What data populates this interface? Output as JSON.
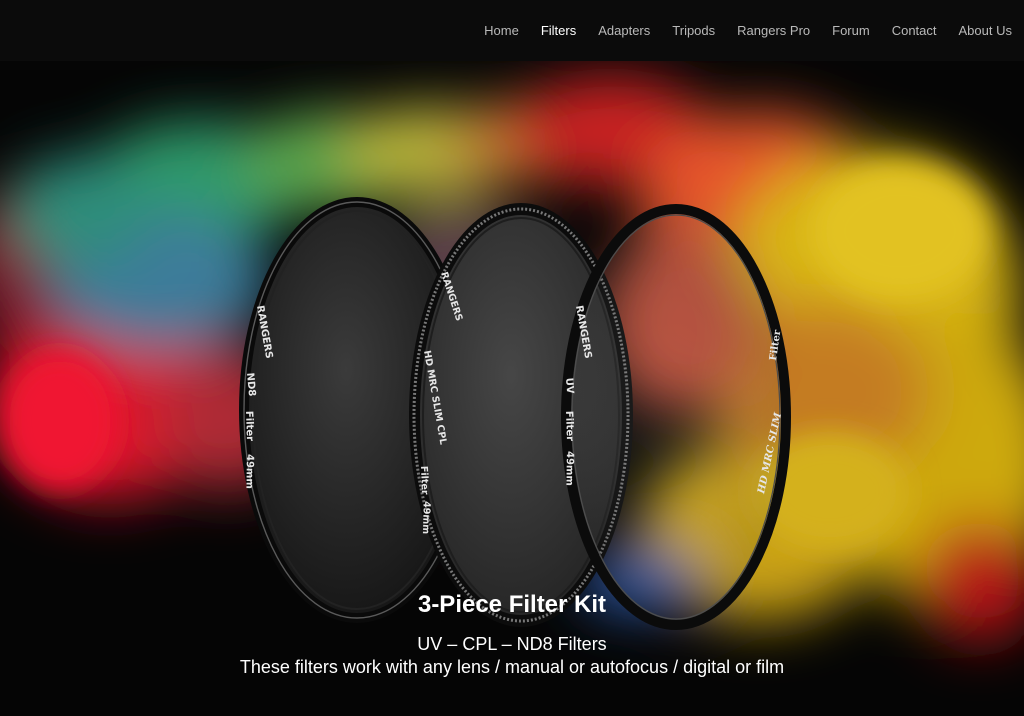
{
  "nav": {
    "items": [
      {
        "label": "Home"
      },
      {
        "label": "Filters"
      },
      {
        "label": "Adapters"
      },
      {
        "label": "Tripods"
      },
      {
        "label": "Rangers Pro"
      },
      {
        "label": "Forum"
      },
      {
        "label": "Contact"
      },
      {
        "label": "About Us"
      }
    ],
    "active": "Filters"
  },
  "hero": {
    "title": "3-Piece Filter Kit",
    "subtitle": "UV – CPL – ND8 Filters",
    "description": "These filters work with any lens / manual or autofocus / digital or film",
    "filters": [
      {
        "name": "nd8",
        "brand": "RANGERS",
        "type": "ND8",
        "label": "Filter",
        "size": "49mm"
      },
      {
        "name": "cpl",
        "brand": "RANGERS",
        "type": "HD MRC SLIM CPL",
        "label": "Filter",
        "size": "49mm"
      },
      {
        "name": "uv",
        "brand": "RANGERS",
        "type": "UV",
        "label": "Filter",
        "size": "49mm",
        "back_text": "HD MRC SLIM",
        "back_label": "Filter"
      }
    ]
  },
  "colors": {
    "background": "#050505",
    "nav_text": "#b9b9b9",
    "nav_active": "#ffffff"
  }
}
